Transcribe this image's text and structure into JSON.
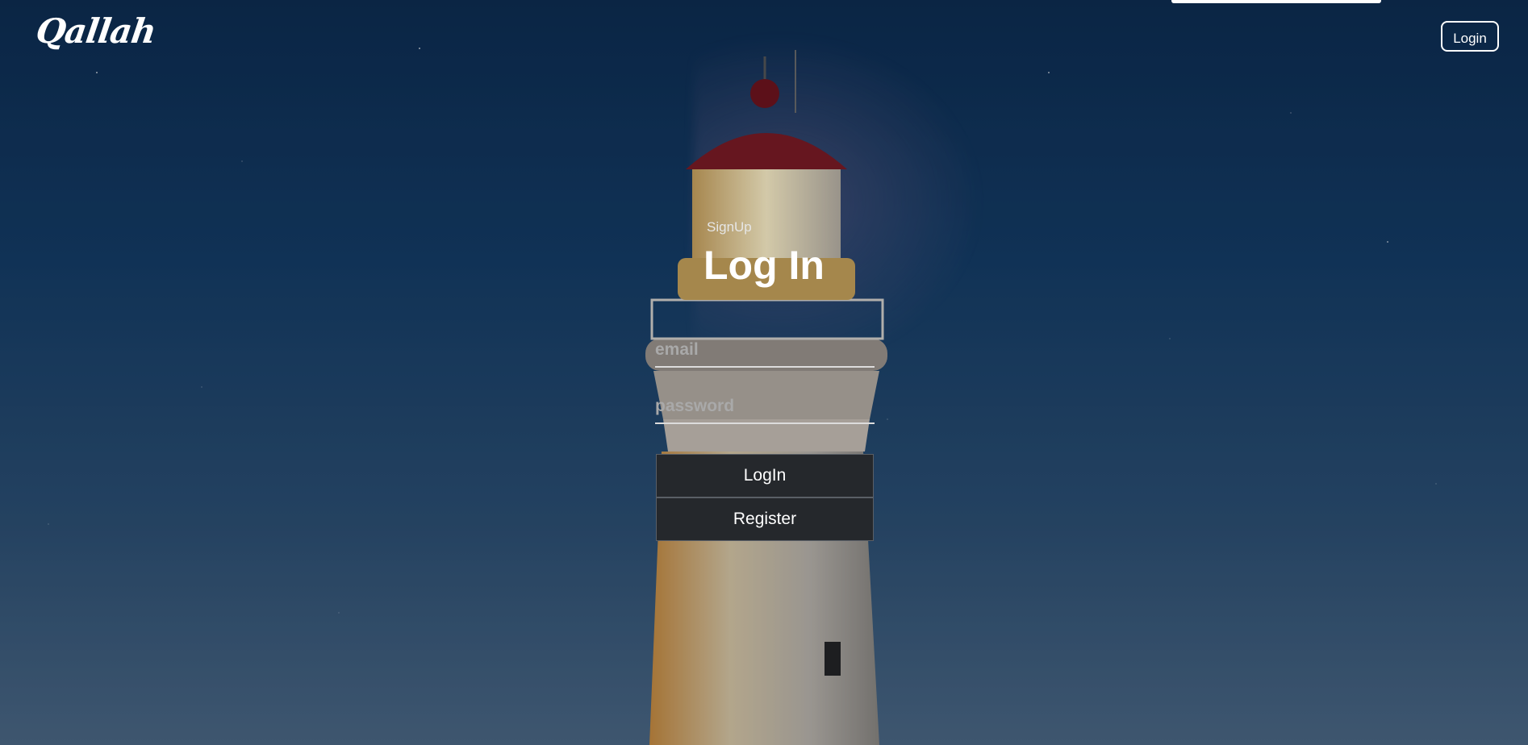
{
  "brand": {
    "name": "Qallah"
  },
  "nav": {
    "login_label": "Login"
  },
  "auth": {
    "signup_link": "SignUp",
    "title": "Log In",
    "email": {
      "placeholder": "email",
      "value": ""
    },
    "password": {
      "placeholder": "password",
      "value": ""
    },
    "login_button": "LogIn",
    "register_button": "Register"
  },
  "colors": {
    "button_bg": "#25282c",
    "text": "#ffffff",
    "placeholder": "#a9a9a9"
  }
}
